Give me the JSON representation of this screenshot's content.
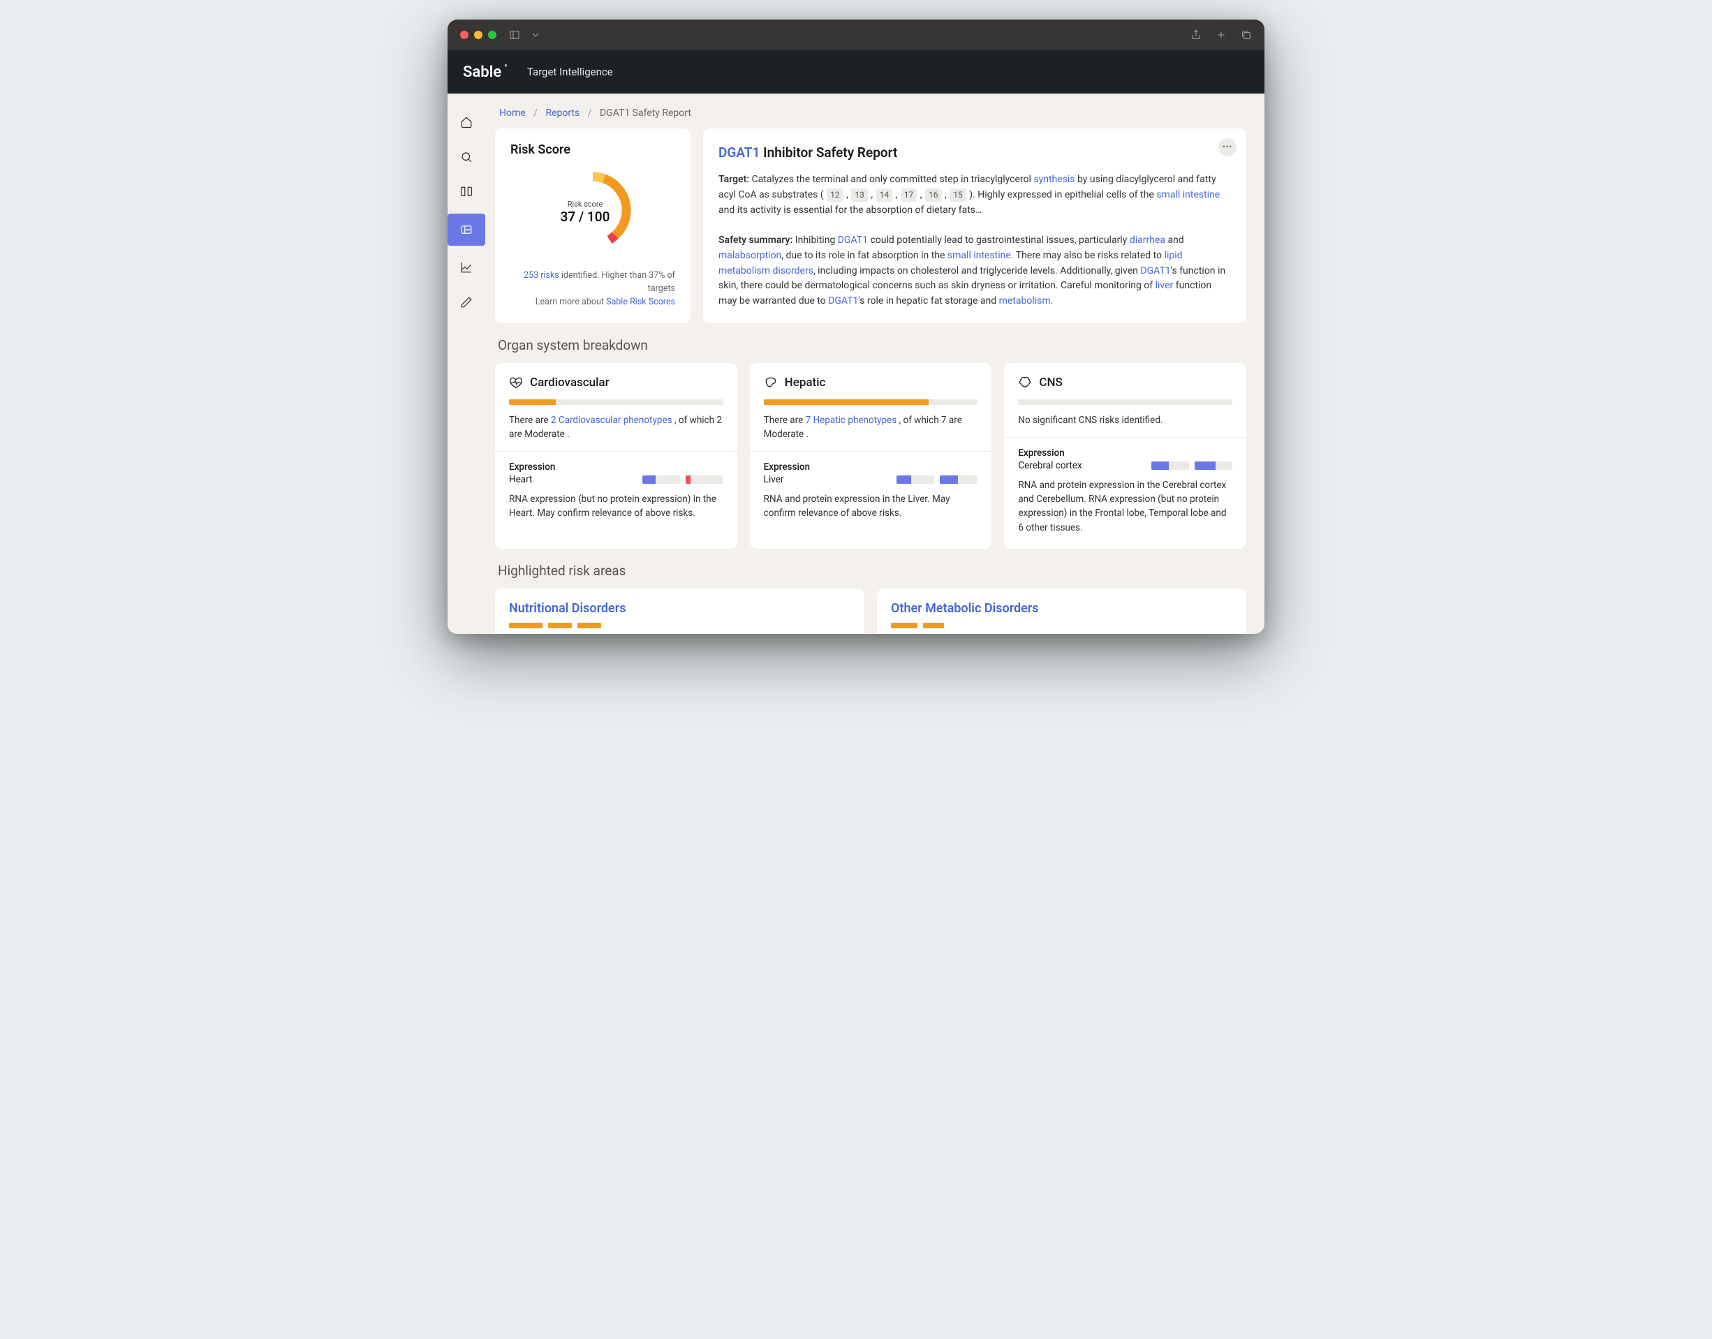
{
  "chrome": {
    "app_subtitle": "Target Intelligence",
    "logo": "Sable"
  },
  "breadcrumbs": {
    "home": "Home",
    "reports": "Reports",
    "current": "DGAT1 Safety Report"
  },
  "risk": {
    "title": "Risk Score",
    "label": "Risk score",
    "score": "37 / 100",
    "risks_count": "253 risks",
    "risks_suffix": " identified. Higher than 37% of targets",
    "learn_prefix": "Learn more about ",
    "learn_link": "Sable Risk Scores"
  },
  "report": {
    "title_hl": "DGAT1",
    "title_rest": " Inhibitor Safety Report",
    "target_label": "Target:",
    "target_t1": " Catalyzes the terminal and only committed step in triacylglycerol ",
    "target_link1": "synthesis",
    "target_t2": " by using diacylglycerol and fatty acyl CoA as substrates (",
    "refs": [
      "12",
      "13",
      "14",
      "17",
      "16",
      "15"
    ],
    "target_t3": "). Highly expressed in epithelial cells of the ",
    "target_link2": "small intestine",
    "target_t4": " and its activity is essential for the absorption of dietary fats…",
    "safety_label": "Safety summary:",
    "s1": " Inhibiting ",
    "s_link1": "DGAT1",
    "s2": " could potentially lead to gastrointestinal issues, particularly ",
    "s_link2": "diarrhea",
    "s3": " and ",
    "s_link3": "malabsorption",
    "s4": ", due to its role in fat absorption in the ",
    "s_link4": "small intestine",
    "s5": ". There may also be risks related to ",
    "s_link5": "lipid metabolism disorders",
    "s6": ", including impacts on cholesterol and triglyceride levels. Additionally, given ",
    "s_link6": "DGAT1",
    "s7": "'s function in skin, there could be dermatological concerns such as skin dryness or irritation. Careful monitoring of ",
    "s_link7": "liver",
    "s8": " function may be warranted due to ",
    "s_link8": "DGAT1",
    "s9": "'s role in hepatic fat storage and ",
    "s_link9": "metabolism",
    "s10": "."
  },
  "organ_section": "Organ system breakdown",
  "organs": {
    "cardio": {
      "title": "Cardiovascular",
      "bar_pct": 22,
      "text_pre": "There are ",
      "text_link": "2 Cardiovascular phenotypes",
      "text_post": " , of which 2 are Moderate .",
      "expr_title": "Expression",
      "tissue": "Heart",
      "seg1_p1": 36,
      "seg1_p2": 0,
      "seg2_p1": 0,
      "seg2_p2": 14,
      "desc": "RNA expression (but no protein expression) in the Heart. May confirm relevance of above risks."
    },
    "hepatic": {
      "title": "Hepatic",
      "bar_pct": 77,
      "text_pre": "There are ",
      "text_link": "7 Hepatic phenotypes",
      "text_post": " , of which 7 are Moderate .",
      "expr_title": "Expression",
      "tissue": "Liver",
      "seg1_p1": 38,
      "seg1_p2": 0,
      "seg2_p1": 48,
      "seg2_p2": 0,
      "desc": "RNA and protein expression in the Liver. May confirm relevance of above risks."
    },
    "cns": {
      "title": "CNS",
      "bar_pct": 0,
      "text": "No significant CNS risks identified.",
      "expr_title": "Expression",
      "tissue": "Cerebral cortex",
      "seg1_p1": 46,
      "seg1_p2": 0,
      "seg2_p1": 56,
      "seg2_p2": 0,
      "desc": "RNA and protein expression in the Cerebral cortex and Cerebellum. RNA expression (but no protein expression) in the Frontal lobe, Temporal lobe and 6 other tissues."
    }
  },
  "highlight_section": "Highlighted risk areas",
  "highlights": {
    "nutritional": "Nutritional Disorders",
    "metabolic": "Other Metabolic Disorders"
  },
  "chart_data": {
    "type": "gauge",
    "value": 37,
    "max": 100,
    "title": "Risk score",
    "colors": {
      "fill": "#f29a1f",
      "tip_high": "#f9c846",
      "tip_low": "#ef3e4a"
    }
  }
}
